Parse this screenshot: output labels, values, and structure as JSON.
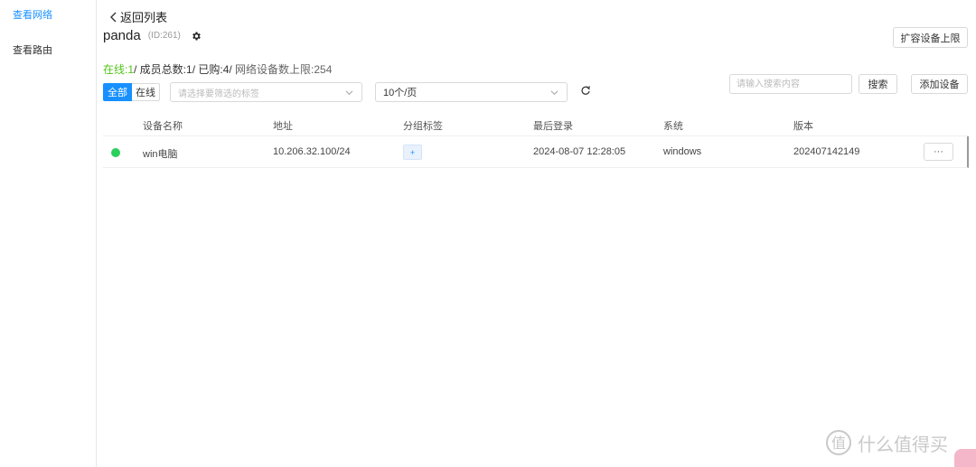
{
  "sidebar": {
    "items": [
      {
        "label": "查看网络"
      },
      {
        "label": "查看路由"
      }
    ]
  },
  "header": {
    "back_label": "返回列表",
    "network_name": "panda",
    "network_id": "(ID:261)",
    "expand_button": "扩容设备上限"
  },
  "stats": {
    "online": "在线:1",
    "members": "/ 成员总数:1/ 已购:4/",
    "limit": " 网络设备数上限:254"
  },
  "filters": {
    "all_label": "全部",
    "online_label": "在线",
    "tag_placeholder": "请选择要筛选的标签",
    "page_size": "10个/页",
    "search_placeholder": "请输入搜索内容",
    "search_button": "搜索",
    "add_button": "添加设备"
  },
  "table": {
    "columns": [
      "设备名称",
      "地址",
      "分组标签",
      "最后登录",
      "系统",
      "版本"
    ],
    "rows": [
      {
        "status": "online",
        "name": "win电脑",
        "address": "10.206.32.100/24",
        "tag": "+",
        "last_login": "2024-08-07 12:28:05",
        "system": "windows",
        "version": "202407142149",
        "more": "···"
      }
    ]
  },
  "watermark": {
    "text": "什么值得买"
  },
  "colors": {
    "accent": "#1890ff",
    "online": "#52c41a",
    "status_dot": "#2bcf5c"
  }
}
